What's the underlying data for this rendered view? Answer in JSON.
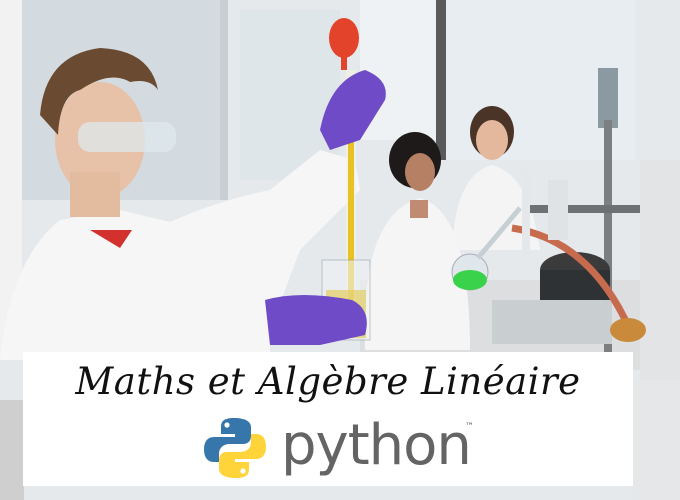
{
  "banner": {
    "title": "Maths et Algèbre Linéaire",
    "logo_word": "python",
    "trademark": "™"
  },
  "colors": {
    "python_blue": "#3776ab",
    "python_yellow": "#ffd43b",
    "logo_text": "#646464",
    "banner_bg": "#ffffff"
  },
  "photo": {
    "subject": "lab-scene"
  }
}
